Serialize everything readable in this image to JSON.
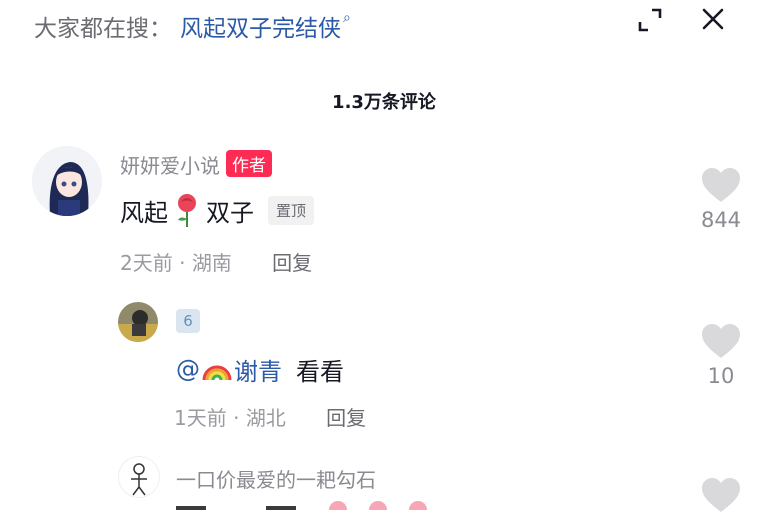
{
  "search": {
    "prefix": "大家都在搜：",
    "term": "风起双子完结侠"
  },
  "comments_count": "1.3万条评论",
  "comments": [
    {
      "username": "妍妍爱小说",
      "badge": "作者",
      "text_before": "风起",
      "emoji": "rose",
      "text_after": "双子",
      "pin_label": "置顶",
      "time": "2天前",
      "location": "湖南",
      "reply_label": "回复",
      "likes": "844"
    },
    {
      "username": "6",
      "mention_prefix": "@",
      "mention_name": "谢青",
      "text": "看看",
      "time": "1天前",
      "location": "湖北",
      "reply_label": "回复",
      "likes": "10"
    },
    {
      "username": "一口价最爱的一耙勾石"
    }
  ],
  "colors": {
    "accent_link": "#2b5aa8",
    "author_badge": "#fe2c55",
    "like_icon": "#d9d9db"
  }
}
